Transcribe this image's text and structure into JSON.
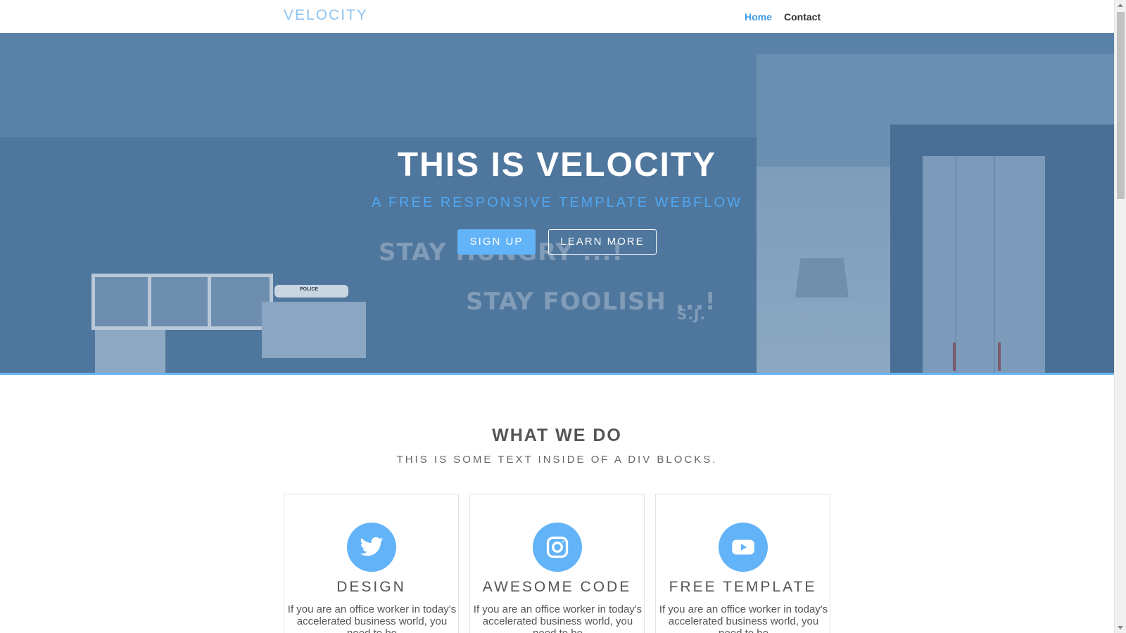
{
  "navbar": {
    "brand": "VELOCITY",
    "links": [
      {
        "label": "Home",
        "active": true
      },
      {
        "label": "Contact",
        "active": false
      }
    ]
  },
  "hero": {
    "title": "THIS IS VELOCITY",
    "subtitle": "A FREE RESPONSIVE TEMPLATE WEBFLOW",
    "signup_label": "SIGN UP",
    "learn_more_label": "LEARN MORE",
    "wall_text_1": "STAY HUNGRY ...!",
    "wall_text_2": "STAY FOOLISH ...!",
    "wall_text_3": "S.J.",
    "toy_car_label": "POLICE"
  },
  "what_we_do": {
    "title": "WHAT WE DO",
    "subtitle": "THIS IS SOME TEXT INSIDE OF A DIV BLOCKS.",
    "cards": [
      {
        "icon": "twitter-icon",
        "title": "DESIGN",
        "text": "If you are an office worker in today's accelerated business world, you need to be"
      },
      {
        "icon": "instagram-icon",
        "title": "AWESOME CODE",
        "text": "If you are an office worker in today's accelerated business world, you need to be"
      },
      {
        "icon": "youtube-icon",
        "title": "FREE TEMPLATE",
        "text": "If you are an office worker in today's accelerated business world, you need to be"
      }
    ]
  },
  "colors": {
    "accent": "#62b3f8",
    "brand": "#8fc4f1",
    "nav_active": "#3f9be5",
    "hero_overlay": "#5a82a8"
  }
}
